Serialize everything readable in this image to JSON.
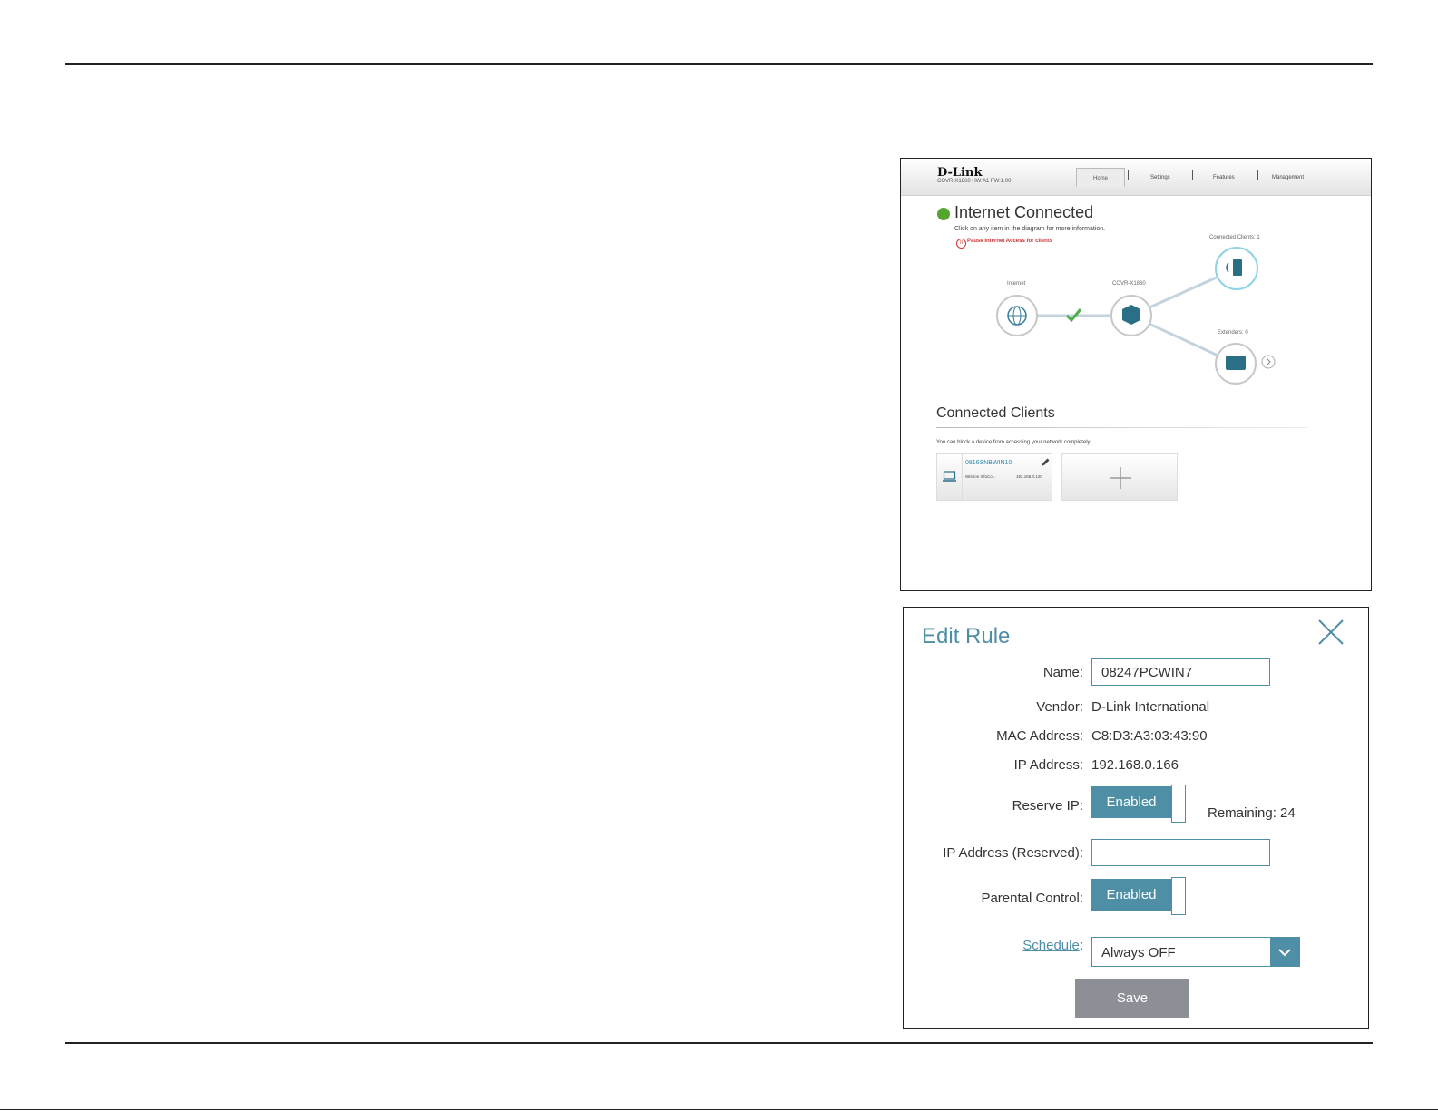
{
  "home": {
    "logo": "D-Link",
    "model": "COVR-X1860 HW:A1 FW:1.00",
    "nav": [
      "Home",
      "Settings",
      "Features",
      "Management"
    ],
    "status_title": "Internet Connected",
    "status_hint": "Click on any item in the diagram for more information.",
    "pause_label": "Pause Internet Access for clients",
    "diagram": {
      "internet_label": "Internet",
      "router_label": "COVR-X1860",
      "clients_label": "Connected Clients: 1",
      "extenders_label": "Extenders: 0"
    },
    "clients_title": "Connected Clients",
    "clients_hint": "You can block a device from accessing your network completely.",
    "client": {
      "name": "0816SNBWIN10",
      "vendor": "Wistron InfoCo...",
      "ip": "192.168.0.120"
    },
    "colors": {
      "accent": "#4f8fa6",
      "status_ok": "#55a630",
      "warning": "#d32f2f"
    }
  },
  "edit_rule": {
    "title": "Edit Rule",
    "name_label": "Name:",
    "name_value": "08247PCWIN7",
    "vendor_label": "Vendor:",
    "vendor_value": "D-Link International",
    "mac_label": "MAC Address:",
    "mac_value": "C8:D3:A3:03:43:90",
    "ip_label": "IP Address:",
    "ip_value": "192.168.0.166",
    "reserve_label": "Reserve IP:",
    "reserve_state": "Enabled",
    "remaining": "Remaining: 24",
    "reserved_ip_label": "IP Address (Reserved):",
    "reserved_ip_value": "",
    "parental_label": "Parental Control:",
    "parental_state": "Enabled",
    "schedule_label": "Schedule",
    "schedule_colon": ":",
    "schedule_value": "Always OFF",
    "save_label": "Save",
    "colors": {
      "accent": "#4f8fa6",
      "save_bg": "#8c8f96"
    }
  }
}
